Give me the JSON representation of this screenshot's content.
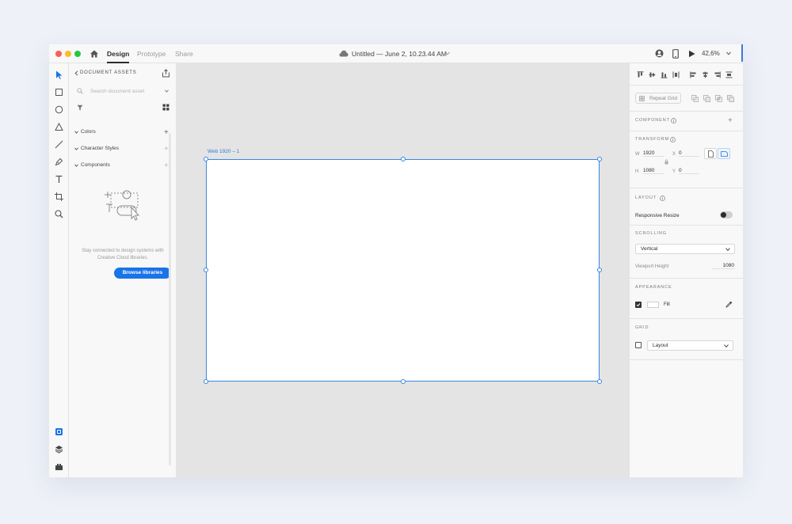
{
  "titlebar": {
    "tabs": [
      {
        "label": "Design",
        "active": true
      },
      {
        "label": "Prototype",
        "active": false
      },
      {
        "label": "Share",
        "active": false
      }
    ],
    "document_title": "Untitled — June 2, 10.23.44 AM",
    "zoom": "42,6%"
  },
  "assets_panel": {
    "title": "DOCUMENT ASSETS",
    "search_placeholder": "Search document asset",
    "sections": [
      {
        "label": "Colors"
      },
      {
        "label": "Character Styles"
      },
      {
        "label": "Components"
      }
    ],
    "empty_state_text": "Stay connected to design systems with Creative Cloud libraries.",
    "browse_button": "Browse libraries"
  },
  "canvas": {
    "artboard_label": "Web 1920 – 1"
  },
  "inspector": {
    "repeat_grid_label": "Repeat Grid",
    "component_title": "COMPONENT",
    "transform_title": "TRANSFORM",
    "transform": {
      "w_label": "W",
      "w_value": "1920",
      "h_label": "H",
      "h_value": "1080",
      "x_label": "X",
      "x_value": "0",
      "y_label": "Y",
      "y_value": "0"
    },
    "layout_title": "LAYOUT",
    "responsive_resize_label": "Responsive Resize",
    "scrolling_title": "SCROLLING",
    "scrolling_value": "Vertical",
    "viewport_height_label": "Viewport Height",
    "viewport_height_value": "1080",
    "appearance_title": "APPEARANCE",
    "fill_label": "Fill",
    "grid_title": "GRID",
    "grid_value": "Layout"
  },
  "colors": {
    "accent": "#1a73e8",
    "artboard_border": "#3a86e0",
    "canvas_bg": "#e4e4e4"
  }
}
